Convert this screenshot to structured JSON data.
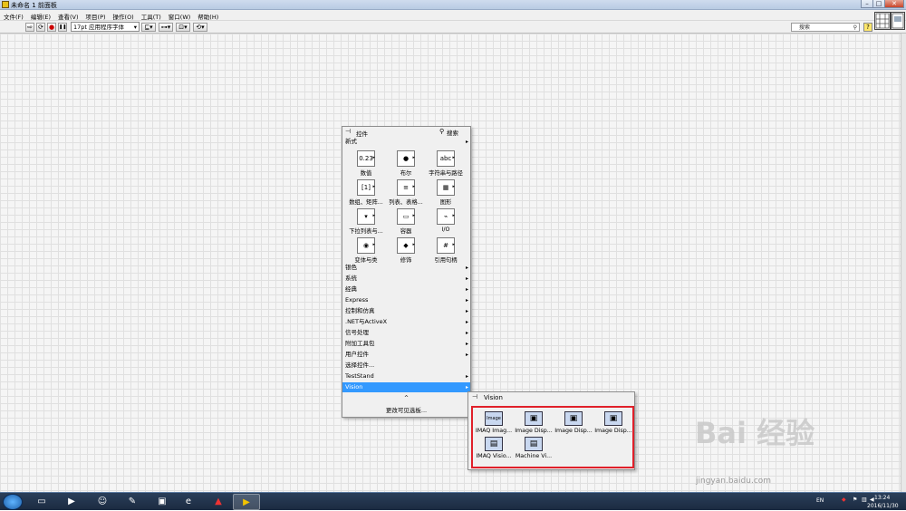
{
  "window": {
    "title": "未命名 1 前面板",
    "min": "–",
    "max": "□",
    "close": "✕"
  },
  "menubar": [
    "文件(F)",
    "编辑(E)",
    "查看(V)",
    "项目(P)",
    "操作(O)",
    "工具(T)",
    "窗口(W)",
    "帮助(H)"
  ],
  "toolbar": {
    "run": "⇨",
    "run_cont": "⟳",
    "abort": "●",
    "pause": "❚❚",
    "font": "17pt 应用程序字体",
    "align": "⊑▾",
    "distribute": "⊶▾",
    "resize": "⊡▾",
    "reorder": "⟲▾",
    "search_placeholder": "搜索",
    "help": "?"
  },
  "palette": {
    "title": "控件",
    "search": "搜索",
    "section": "新式",
    "grid": [
      {
        "label": "数值",
        "icon": "numeric-icon",
        "glyph": "0.23"
      },
      {
        "label": "布尔",
        "icon": "boolean-icon",
        "glyph": "●"
      },
      {
        "label": "字符串与路径",
        "icon": "string-path-icon",
        "glyph": "abc"
      },
      {
        "label": "数组、矩阵...",
        "icon": "array-matrix-icon",
        "glyph": "[1]"
      },
      {
        "label": "列表、表格...",
        "icon": "list-table-icon",
        "glyph": "≡"
      },
      {
        "label": "图形",
        "icon": "graph-icon",
        "glyph": "▦"
      },
      {
        "label": "下拉列表与...",
        "icon": "ring-enum-icon",
        "glyph": "▾"
      },
      {
        "label": "容器",
        "icon": "container-icon",
        "glyph": "▭"
      },
      {
        "label": "I/O",
        "icon": "io-icon",
        "glyph": "⌁"
      },
      {
        "label": "变体与类",
        "icon": "variant-class-icon",
        "glyph": "◉"
      },
      {
        "label": "修饰",
        "icon": "decorations-icon",
        "glyph": "◆"
      },
      {
        "label": "引用句柄",
        "icon": "refnum-icon",
        "glyph": "#"
      }
    ],
    "rows": [
      "银色",
      "系统",
      "经典",
      "Express",
      "控制和仿真",
      ".NET与ActiveX",
      "信号处理",
      "附加工具包",
      "用户控件",
      "选择控件...",
      "TestStand",
      "Vision"
    ],
    "row_arrows": [
      true,
      true,
      true,
      true,
      true,
      true,
      true,
      true,
      true,
      false,
      true,
      true
    ],
    "selected": "Vision",
    "expand": "^",
    "footer": "更改可见选板..."
  },
  "vision": {
    "title": "Vision",
    "items": [
      {
        "label": "IMAQ Imag...",
        "icon": "imaq-image-icon",
        "glyph": "Image"
      },
      {
        "label": "Image Disp...",
        "icon": "image-display-icon",
        "glyph": "▣"
      },
      {
        "label": "Image Disp...",
        "icon": "image-display-icon",
        "glyph": "▣"
      },
      {
        "label": "Image Disp...",
        "icon": "image-display-icon",
        "glyph": "▣"
      },
      {
        "label": "IMAQ Visio...",
        "icon": "imaq-vision-icon",
        "glyph": "▤"
      },
      {
        "label": "Machine Vi...",
        "icon": "machine-vision-icon",
        "glyph": "▤"
      }
    ]
  },
  "taskbar": {
    "lang": "EN",
    "time": "13:24",
    "date": "2016/11/30"
  },
  "watermark": {
    "text": "Bai 经验",
    "url": "jingyan.baidu.com"
  }
}
